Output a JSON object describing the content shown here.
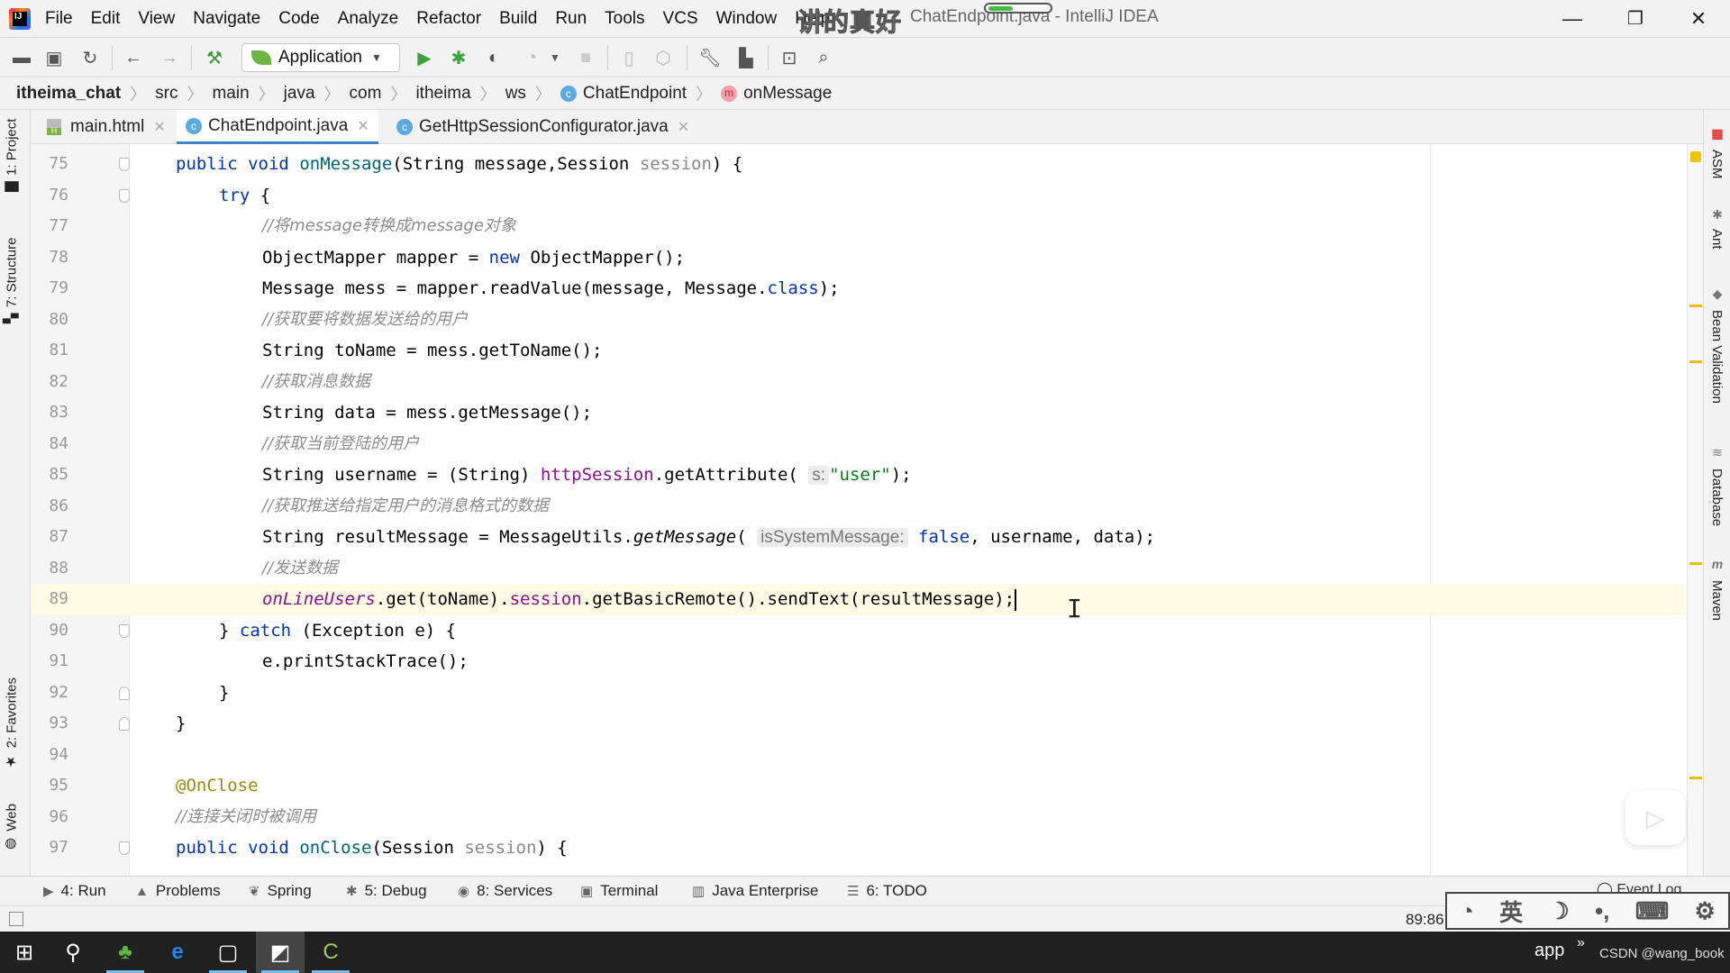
{
  "window": {
    "title": "ChatEndpoint.java - IntelliJ IDEA",
    "subtitle_overlay": "讲的真好",
    "progress_fraction": 0.4,
    "controls": {
      "minimize": "—",
      "restore": "❐",
      "close": "✕"
    }
  },
  "menu": [
    "File",
    "Edit",
    "View",
    "Navigate",
    "Code",
    "Analyze",
    "Refactor",
    "Build",
    "Run",
    "Tools",
    "VCS",
    "Window",
    "Help"
  ],
  "toolbar": {
    "run_config": "Application",
    "icons": [
      "open-folder-icon",
      "save-icon",
      "sync-icon",
      "back-icon",
      "forward-icon",
      "build-hammer-icon",
      "run-icon",
      "debug-icon",
      "coverage-icon",
      "profile-icon",
      "stop-icon",
      "device-icon",
      "dependency-icon",
      "settings-wrench-icon",
      "project-structure-icon",
      "run-window-icon",
      "search-icon"
    ]
  },
  "breadcrumb": [
    {
      "label": "itheima_chat",
      "badge": ""
    },
    {
      "label": "src",
      "badge": ""
    },
    {
      "label": "main",
      "badge": ""
    },
    {
      "label": "java",
      "badge": ""
    },
    {
      "label": "com",
      "badge": ""
    },
    {
      "label": "itheima",
      "badge": ""
    },
    {
      "label": "ws",
      "badge": ""
    },
    {
      "label": "ChatEndpoint",
      "badge": "c"
    },
    {
      "label": "onMessage",
      "badge": "m"
    }
  ],
  "tabs": [
    {
      "label": "main.html",
      "active": false
    },
    {
      "label": "ChatEndpoint.java",
      "active": true
    },
    {
      "label": "GetHttpSessionConfigurator.java",
      "active": false
    }
  ],
  "left_tool_windows": [
    "1: Project",
    "7: Structure",
    "2: Favorites",
    "Web"
  ],
  "right_tool_windows": [
    "ASM",
    "Ant",
    "Bean Validation",
    "Database",
    "Maven"
  ],
  "editor": {
    "current_line": 89,
    "lines": [
      {
        "n": "75",
        "fold": "down"
      },
      {
        "n": "76",
        "fold": "down"
      },
      {
        "n": "77",
        "fold": ""
      },
      {
        "n": "78",
        "fold": ""
      },
      {
        "n": "79",
        "fold": ""
      },
      {
        "n": "80",
        "fold": ""
      },
      {
        "n": "81",
        "fold": ""
      },
      {
        "n": "82",
        "fold": ""
      },
      {
        "n": "83",
        "fold": ""
      },
      {
        "n": "84",
        "fold": ""
      },
      {
        "n": "85",
        "fold": ""
      },
      {
        "n": "86",
        "fold": ""
      },
      {
        "n": "87",
        "fold": ""
      },
      {
        "n": "88",
        "fold": ""
      },
      {
        "n": "89",
        "fold": ""
      },
      {
        "n": "90",
        "fold": "down"
      },
      {
        "n": "91",
        "fold": ""
      },
      {
        "n": "92",
        "fold": "up"
      },
      {
        "n": "93",
        "fold": "up"
      },
      {
        "n": "94",
        "fold": ""
      },
      {
        "n": "95",
        "fold": ""
      },
      {
        "n": "96",
        "fold": ""
      },
      {
        "n": "97",
        "fold": "down"
      }
    ],
    "tokens": {
      "l75": [
        "public",
        "void",
        "onMessage",
        "(String message,Session ",
        "session",
        ") {"
      ],
      "l76": [
        "try",
        " {"
      ],
      "l77": "//将message转换成message对象",
      "l78": [
        "ObjectMapper mapper = ",
        "new",
        " ObjectMapper();"
      ],
      "l79": [
        "Message mess = mapper.readValue(message, Message.",
        "class",
        ");"
      ],
      "l80": "//获取要将数据发送给的用户",
      "l81": "String toName = mess.getToName();",
      "l82": "//获取消息数据",
      "l83": "String data = mess.getMessage();",
      "l84": "//获取当前登陆的用户",
      "l85": [
        "String username = (String) ",
        "httpSession",
        ".getAttribute( ",
        "s:",
        "\"user\"",
        ");"
      ],
      "l86": "//获取推送给指定用户的消息格式的数据",
      "l87": [
        "String resultMessage = MessageUtils.",
        "getMessage",
        "( ",
        "isSystemMessage:",
        "false",
        ", username, data);"
      ],
      "l88": "//发送数据",
      "l89": [
        "onLineUsers",
        ".get(toName).",
        "session",
        ".getBasicRemote().sendText(resultMessage);"
      ],
      "l90": [
        "} ",
        "catch",
        " (Exception e) {"
      ],
      "l91": "e.printStackTrace();",
      "l92": "}",
      "l93": "}",
      "l94": "",
      "l95": "@OnClose",
      "l96": "//连接关闭时被调用",
      "l97": [
        "public",
        "void",
        "onClose",
        "(Session ",
        "session",
        ") {"
      ]
    }
  },
  "bottom_tool_windows": [
    {
      "label": "4: Run",
      "icon": "▶"
    },
    {
      "label": "Problems",
      "icon": "▲"
    },
    {
      "label": "Spring",
      "icon": "❦"
    },
    {
      "label": "5: Debug",
      "icon": "✱"
    },
    {
      "label": "8: Services",
      "icon": "◉"
    },
    {
      "label": "Terminal",
      "icon": "▣"
    },
    {
      "label": "Java Enterprise",
      "icon": "▥"
    },
    {
      "label": "6: TODO",
      "icon": "☰"
    }
  ],
  "event_log": "Event Log",
  "status": {
    "caret_position": "89:86"
  },
  "ime": {
    "items": [
      "◔",
      "英",
      "☽",
      "•,",
      "⌨",
      "⚙"
    ]
  },
  "taskbar": {
    "apps": [
      "windows-start",
      "search",
      "clover",
      "edge",
      "typora",
      "intellij-idea",
      "camtasia"
    ],
    "tray_label": "app",
    "watermark": "CSDN @wang_book"
  }
}
